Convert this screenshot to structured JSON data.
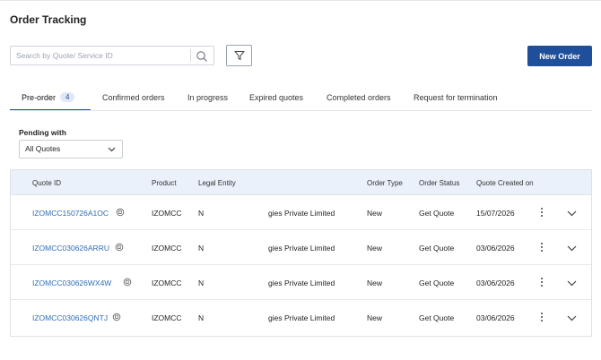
{
  "page": {
    "title": "Order Tracking"
  },
  "search": {
    "placeholder": "Search by Quote/ Service ID",
    "value": ""
  },
  "toolbar": {
    "new_order_label": "New Order"
  },
  "tabs": [
    {
      "label": "Pre-order",
      "count": "4",
      "active": true
    },
    {
      "label": "Confirmed orders"
    },
    {
      "label": "In progress"
    },
    {
      "label": "Expired quotes"
    },
    {
      "label": "Completed orders"
    },
    {
      "label": "Request for termination"
    }
  ],
  "filter": {
    "pending_label": "Pending with",
    "selected": "All Quotes"
  },
  "table": {
    "columns": [
      "Quote ID",
      "Product",
      "Legal Entity",
      "Order Type",
      "Order Status",
      "Quote Created on"
    ],
    "rows": [
      {
        "quote_id": "IZOMCC150726A1OC",
        "product": "IZOMCC",
        "legal_entity_prefix": "N",
        "legal_entity_suffix": "gies Private Limited",
        "order_type": "New",
        "order_status": "Get Quote",
        "created_on": "15/07/2026"
      },
      {
        "quote_id": "IZOMCC030626ARRU",
        "product": "IZOMCC",
        "legal_entity_prefix": "N",
        "legal_entity_suffix": "gies Private Limited",
        "order_type": "New",
        "order_status": "Get Quote",
        "created_on": "03/06/2026"
      },
      {
        "quote_id": "IZOMCC030626WX4W",
        "product": "IZOMCC",
        "legal_entity_prefix": "N",
        "legal_entity_suffix": "gies Private Limited",
        "order_type": "New",
        "order_status": "Get Quote",
        "created_on": "03/06/2026"
      },
      {
        "quote_id": "IZOMCC030626QNTJ",
        "product": "IZOMCC",
        "legal_entity_prefix": "N",
        "legal_entity_suffix": "gies Private Limited",
        "order_type": "New",
        "order_status": "Get Quote",
        "created_on": "03/06/2026"
      }
    ]
  },
  "colors": {
    "primary": "#1f4f9a",
    "link": "#2f6db5",
    "header_bg": "#eaf1fa",
    "badge_bg": "#dfe8f6"
  },
  "icons": {
    "search": "search-icon",
    "filter": "filter-icon",
    "copy": "copy-icon",
    "more": "kebab-menu-icon",
    "expand": "chevron-down-icon",
    "dropdown": "chevron-down-icon"
  }
}
